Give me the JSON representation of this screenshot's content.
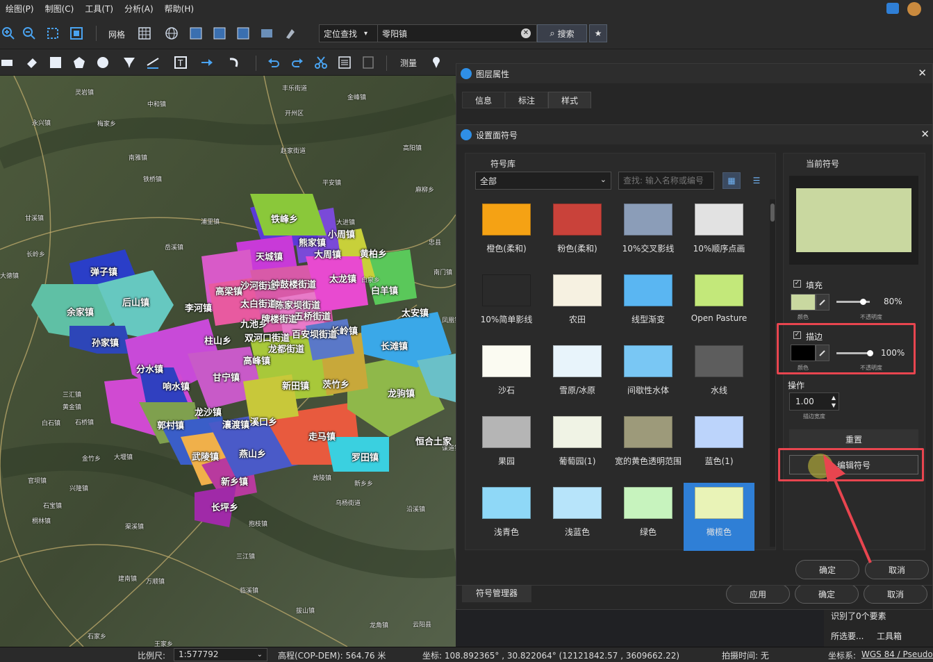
{
  "menu": [
    "绘图(P)",
    "制图(C)",
    "工具(T)",
    "分析(A)",
    "帮助(H)"
  ],
  "toolbar": {
    "grid_label": "网格",
    "search_mode": "定位查找",
    "search_value": "零阳镇",
    "search_button": "搜索",
    "measure_label": "测量"
  },
  "map": {
    "towns": [
      {
        "name": "弹子镇"
      },
      {
        "name": "后山镇"
      },
      {
        "name": "余家镇"
      },
      {
        "name": "孙家镇"
      },
      {
        "name": "分水镇"
      },
      {
        "name": "响水镇"
      },
      {
        "name": "甘宁镇"
      },
      {
        "name": "龙沙镇"
      },
      {
        "name": "郭村镇"
      },
      {
        "name": "武陵镇"
      },
      {
        "name": "燕山乡"
      },
      {
        "name": "新乡镇"
      },
      {
        "name": "长坪乡"
      },
      {
        "name": "走马镇"
      },
      {
        "name": "罗田镇"
      },
      {
        "name": "龙驹镇"
      },
      {
        "name": "长滩镇"
      },
      {
        "name": "太安镇"
      },
      {
        "name": "白羊镇"
      },
      {
        "name": "黄柏乡"
      },
      {
        "name": "大周镇"
      },
      {
        "name": "小周镇"
      },
      {
        "name": "熊家镇"
      },
      {
        "name": "铁峰乡"
      },
      {
        "name": "天城镇"
      },
      {
        "name": "高梁镇"
      },
      {
        "name": "李河镇"
      },
      {
        "name": "柱山乡"
      },
      {
        "name": "高峰镇"
      },
      {
        "name": "新田镇"
      },
      {
        "name": "茨竹乡"
      },
      {
        "name": "瀼渡镇"
      },
      {
        "name": "溪口乡"
      },
      {
        "name": "恒合土家"
      },
      {
        "name": "太龙镇"
      },
      {
        "name": "长岭镇"
      },
      {
        "name": "双河口街道"
      },
      {
        "name": "龙都街道"
      },
      {
        "name": "九池乡"
      },
      {
        "name": "沙河街道"
      },
      {
        "name": "钟鼓楼街道"
      },
      {
        "name": "太白街道"
      },
      {
        "name": "陈家坝街道"
      },
      {
        "name": "牌楼街道"
      },
      {
        "name": "五桥街道"
      },
      {
        "name": "百安坝街道"
      }
    ],
    "small_labels": [
      "灵岩镇",
      "中和镇",
      "永兴镇",
      "梅家乡",
      "南雅镇",
      "铁桥镇",
      "甘溪镇",
      "长岭乡",
      "大德镇",
      "丰乐街道",
      "开州区",
      "赵家街道",
      "平安镇",
      "浦里镇",
      "岳溪镇",
      "金峰镇",
      "高阳镇",
      "麻柳乡",
      "大进镇",
      "白泉乡",
      "南门镇",
      "凤凰镇",
      "三汇镇",
      "黄金镇",
      "石桥镇",
      "白石镇",
      "官坝镇",
      "桐林镇",
      "石宝镇",
      "大堰镇",
      "渠溪镇",
      "抱枝镇",
      "三江镇",
      "临溪镇",
      "王家乡",
      "石家乡",
      "万顺镇",
      "乌杨街道",
      "沿溪镇",
      "建南镇",
      "谋道镇",
      "忠县",
      "云阳县",
      "拔山镇",
      "龙角镇",
      "故陵镇",
      "新乡乡",
      "兴隆镇",
      "金竹乡"
    ]
  },
  "layer_dialog": {
    "title": "图层属性",
    "tabs": [
      "信息",
      "标注",
      "样式"
    ],
    "active_tab": "样式",
    "bottom_buttons": {
      "apply": "应用",
      "ok": "确定",
      "cancel": "取消"
    },
    "symbol_manager": "符号管理器"
  },
  "symbol_dialog": {
    "title": "设置面符号",
    "library_label": "符号库",
    "library_value": "全部",
    "search_placeholder": "查找: 输入名称或编号",
    "current_symbol_label": "当前符号",
    "current_symbol_color": "#c9d8a0",
    "fill": {
      "label": "填充",
      "checked": true,
      "color": "#c9d8a0",
      "color_label": "颜色",
      "opacity": "80%",
      "opacity_value": 0.8,
      "opacity_label": "不透明度"
    },
    "stroke": {
      "label": "描边",
      "checked": true,
      "color": "#000000",
      "color_label": "颜色",
      "opacity": "100%",
      "opacity_value": 1.0,
      "opacity_label": "不透明度"
    },
    "operation_label": "操作",
    "stroke_width": "1.00",
    "stroke_width_label": "描边宽度",
    "reset_button": "重置",
    "edit_symbol_button": "编辑符号",
    "ok": "确定",
    "cancel": "取消",
    "symbols": [
      {
        "name": "橙色(柔和)",
        "color": "#f5a214"
      },
      {
        "name": "粉色(柔和)",
        "color": "#c9423a"
      },
      {
        "name": "10%交叉影线",
        "color": "#8b9db8"
      },
      {
        "name": "10%顺序点画",
        "color": "#e2e2e2"
      },
      {
        "name": "10%简单影线",
        "color": "#2a2a2a"
      },
      {
        "name": "农田",
        "color": "#f6f1e1"
      },
      {
        "name": "线型渐变",
        "color": "#5ab6f2"
      },
      {
        "name": "Open Pasture",
        "color": "#c3e87a"
      },
      {
        "name": "沙石",
        "color": "#fbfbf2"
      },
      {
        "name": "雪原/冰原",
        "color": "#e8f4fb"
      },
      {
        "name": "间歇性水体",
        "color": "#79c7f4"
      },
      {
        "name": "水线",
        "color": "#5d5d5d"
      },
      {
        "name": "果园",
        "color": "#b5b5b5"
      },
      {
        "name": "葡萄园(1)",
        "color": "#f0f3e5"
      },
      {
        "name": "宽的黄色透明范围",
        "color": "#9d9a7a"
      },
      {
        "name": "蓝色(1)",
        "color": "#bcd4fb"
      },
      {
        "name": "浅青色",
        "color": "#8fd8f7"
      },
      {
        "name": "浅蓝色",
        "color": "#b7e4fa"
      },
      {
        "name": "绿色",
        "color": "#c7f3be"
      },
      {
        "name": "橄榄色",
        "color": "#e9f3b7"
      }
    ],
    "selected_symbol": "橄榄色"
  },
  "side_panel": {
    "text1": "识别了0个要素",
    "text2": "所选要...",
    "toolbox": "工具箱"
  },
  "status": {
    "scale_label": "比例尺:",
    "scale_value": "1:577792",
    "elevation": "高程(COP-DEM): 564.76 米",
    "coords": "坐标: 108.892365° , 30.822064° (12121842.57 , 3609662.22)",
    "capture_time": "拍摄时间: 无",
    "crs_label": "坐标系:",
    "crs_value": "WGS 84 / Pseudo-"
  },
  "colors": {
    "highlight": "#e8454f",
    "selected_cell": "#2f7fd6"
  }
}
